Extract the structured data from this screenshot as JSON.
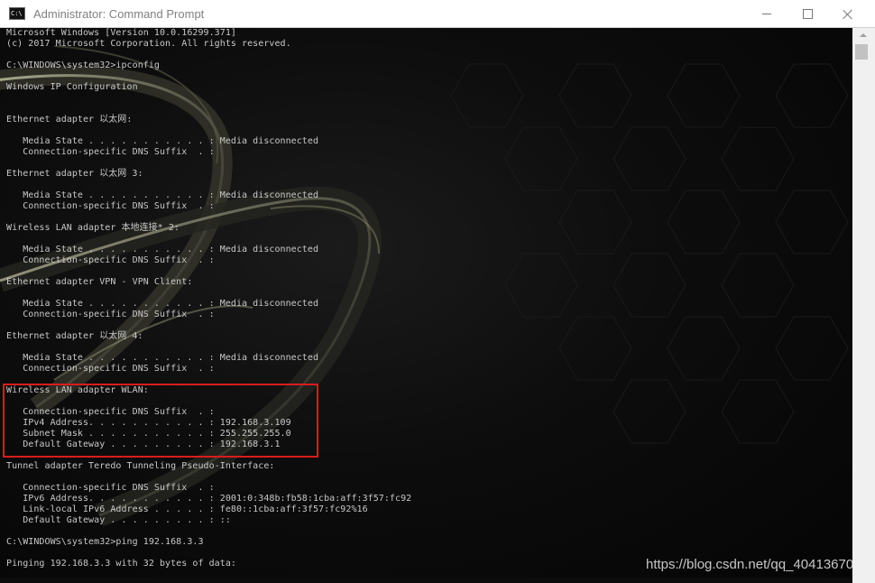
{
  "window": {
    "title": "Administrator: Command Prompt",
    "icon_name": "cmd-icon",
    "icon_text": "C:\\",
    "controls": [
      "minimize-icon",
      "maximize-icon",
      "close-icon"
    ]
  },
  "console": {
    "lines": [
      "Microsoft Windows [Version 10.0.16299.371]",
      "(c) 2017 Microsoft Corporation. All rights reserved.",
      "",
      "C:\\WINDOWS\\system32>ipconfig",
      "",
      "Windows IP Configuration",
      "",
      "",
      "Ethernet adapter 以太网:",
      "",
      "   Media State . . . . . . . . . . . : Media disconnected",
      "   Connection-specific DNS Suffix  . :",
      "",
      "Ethernet adapter 以太网 3:",
      "",
      "   Media State . . . . . . . . . . . : Media disconnected",
      "   Connection-specific DNS Suffix  . :",
      "",
      "Wireless LAN adapter 本地连接* 2:",
      "",
      "   Media State . . . . . . . . . . . : Media disconnected",
      "   Connection-specific DNS Suffix  . :",
      "",
      "Ethernet adapter VPN - VPN Client:",
      "",
      "   Media State . . . . . . . . . . . : Media disconnected",
      "   Connection-specific DNS Suffix  . :",
      "",
      "Ethernet adapter 以太网 4:",
      "",
      "   Media State . . . . . . . . . . . : Media disconnected",
      "   Connection-specific DNS Suffix  . :",
      "",
      "Wireless LAN adapter WLAN:",
      "",
      "   Connection-specific DNS Suffix  . :",
      "   IPv4 Address. . . . . . . . . . . : 192.168.3.109",
      "   Subnet Mask . . . . . . . . . . . : 255.255.255.0",
      "   Default Gateway . . . . . . . . . : 192.168.3.1",
      "",
      "Tunnel adapter Teredo Tunneling Pseudo-Interface:",
      "",
      "   Connection-specific DNS Suffix  . :",
      "   IPv6 Address. . . . . . . . . . . : 2001:0:348b:fb58:1cba:aff:3f57:fc92",
      "   Link-local IPv6 Address . . . . . : fe80::1cba:aff:3f57:fc92%16",
      "   Default Gateway . . . . . . . . . : ::",
      "",
      "C:\\WINDOWS\\system32>ping 192.168.3.3",
      "",
      "Pinging 192.168.3.3 with 32 bytes of data:"
    ]
  },
  "highlight_color": "#d91c1c",
  "watermark": "https://blog.csdn.net/qq_40413670"
}
